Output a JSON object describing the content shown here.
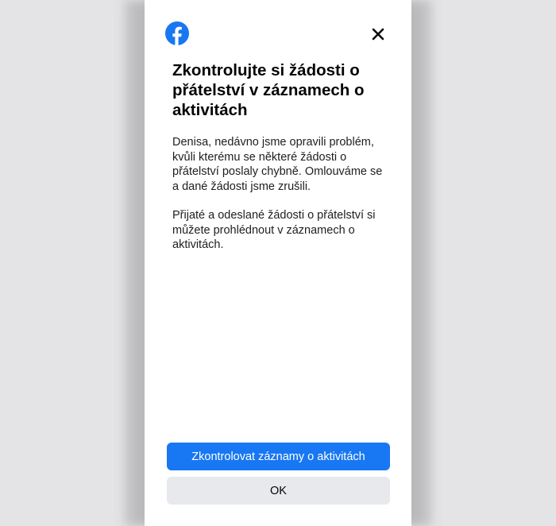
{
  "dialog": {
    "title": "Zkontrolujte si žádosti o přátelství v záznamech o aktivitách",
    "paragraph_1": "Denisa, nedávno jsme opravili problém, kvůli kterému se některé žádosti o přátelství poslaly chybně. Omlouváme se a dané žádosti jsme zrušili.",
    "paragraph_2": "Přijaté a odeslané žádosti o přátelství si můžete prohlédnout v záznamech o aktivitách.",
    "primary_button_label": "Zkontrolovat záznamy o aktivitách",
    "secondary_button_label": "OK"
  },
  "icons": {
    "logo": "facebook-logo-icon",
    "close": "close-icon"
  },
  "colors": {
    "brand": "#1877f2",
    "secondary_button": "#e8e9ed",
    "background": "#e4e4e6",
    "text": "#050505"
  }
}
